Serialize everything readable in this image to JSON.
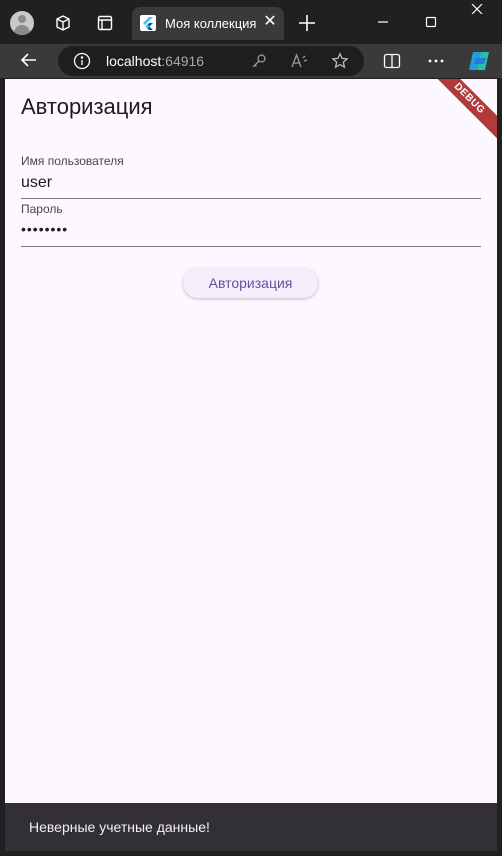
{
  "browser": {
    "tab": {
      "title": "Моя коллекция"
    },
    "address": {
      "host": "localhost",
      "port": ":64916"
    }
  },
  "page": {
    "title": "Авторизация",
    "username": {
      "label": "Имя пользователя",
      "value": "user"
    },
    "password": {
      "label": "Пароль",
      "value": "••••••••"
    },
    "submit_label": "Авторизация",
    "debug_banner": "DEBUG"
  },
  "snackbar": {
    "message": "Неверные учетные данные!"
  },
  "colors": {
    "page_background": "#fdf7ff",
    "primary": "#6750a4",
    "debug_banner": "#b13b3b",
    "snackbar": "#322f35"
  }
}
